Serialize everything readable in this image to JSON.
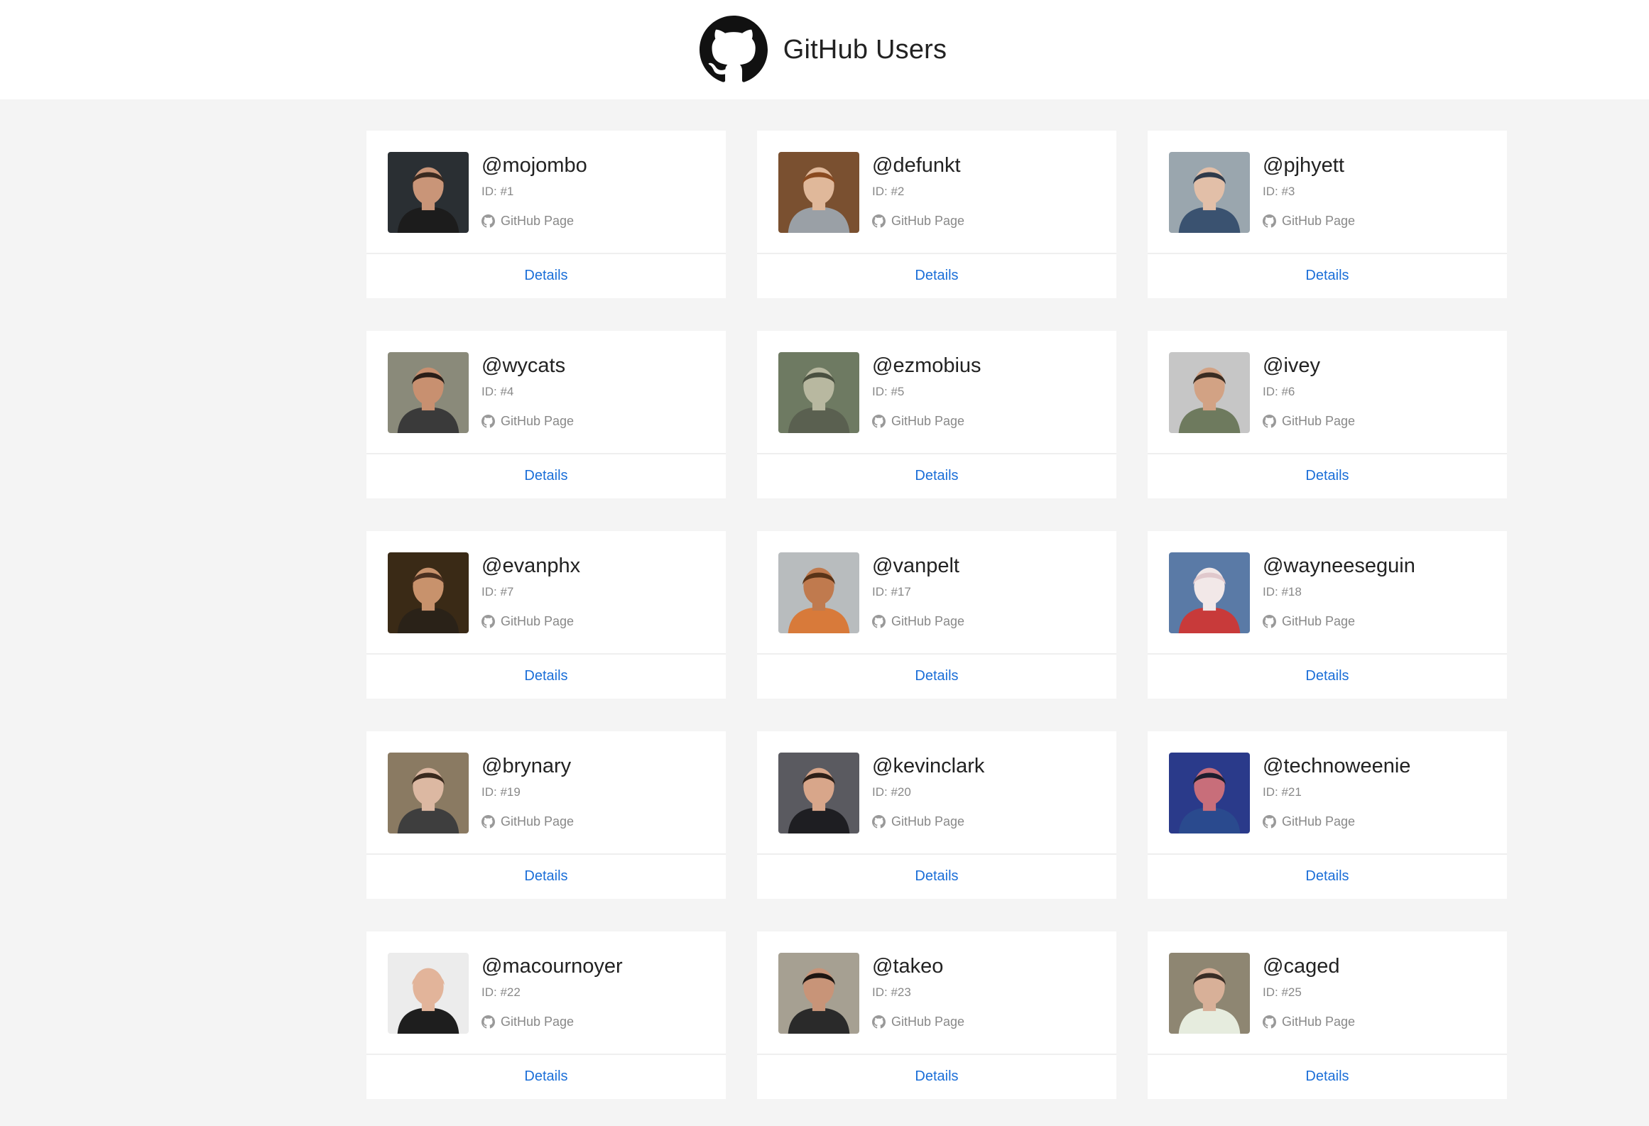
{
  "header": {
    "title": "GitHub Users",
    "logo_icon": "github-octocat-icon"
  },
  "colors": {
    "link": "#1a6ed8",
    "background": "#f4f4f4",
    "card": "#ffffff",
    "muted": "#888888"
  },
  "users": [
    {
      "login": "@mojombo",
      "id": "ID: #1",
      "link_label": "GitHub Page",
      "details_label": "Details",
      "avatar": {
        "bg": "#2a2f33",
        "skin": "#c99578",
        "hair": "#3a2a20",
        "shirt": "#1c1c1c"
      }
    },
    {
      "login": "@defunkt",
      "id": "ID: #2",
      "link_label": "GitHub Page",
      "details_label": "Details",
      "avatar": {
        "bg": "#7a5030",
        "skin": "#e0b89a",
        "hair": "#8a4a20",
        "shirt": "#9aa0a6"
      }
    },
    {
      "login": "@pjhyett",
      "id": "ID: #3",
      "link_label": "GitHub Page",
      "details_label": "Details",
      "avatar": {
        "bg": "#9aa6ae",
        "skin": "#e2bfa8",
        "hair": "#2f3a4a",
        "shirt": "#3a5270"
      }
    },
    {
      "login": "@wycats",
      "id": "ID: #4",
      "link_label": "GitHub Page",
      "details_label": "Details",
      "avatar": {
        "bg": "#8a8a7a",
        "skin": "#c89070",
        "hair": "#2a1e18",
        "shirt": "#3a3a3a"
      }
    },
    {
      "login": "@ezmobius",
      "id": "ID: #5",
      "link_label": "GitHub Page",
      "details_label": "Details",
      "avatar": {
        "bg": "#6e7a62",
        "skin": "#b8b8a0",
        "hair": "#4a5040",
        "shirt": "#5a6050"
      }
    },
    {
      "login": "@ivey",
      "id": "ID: #6",
      "link_label": "GitHub Page",
      "details_label": "Details",
      "avatar": {
        "bg": "#c6c6c6",
        "skin": "#d2a284",
        "hair": "#3a2c22",
        "shirt": "#6e7a5e"
      }
    },
    {
      "login": "@evanphx",
      "id": "ID: #7",
      "link_label": "GitHub Page",
      "details_label": "Details",
      "avatar": {
        "bg": "#3a2a16",
        "skin": "#c8926c",
        "hair": "#4a3020",
        "shirt": "#2a2218"
      }
    },
    {
      "login": "@vanpelt",
      "id": "ID: #17",
      "link_label": "GitHub Page",
      "details_label": "Details",
      "avatar": {
        "bg": "#b8bcbe",
        "skin": "#c07a4e",
        "hair": "#5a3418",
        "shirt": "#d87a3a"
      }
    },
    {
      "login": "@wayneeseguin",
      "id": "ID: #18",
      "link_label": "GitHub Page",
      "details_label": "Details",
      "avatar": {
        "bg": "#5a7aa6",
        "skin": "#f2e8e8",
        "hair": "#e0c8cc",
        "shirt": "#c83a3a"
      }
    },
    {
      "login": "@brynary",
      "id": "ID: #19",
      "link_label": "GitHub Page",
      "details_label": "Details",
      "avatar": {
        "bg": "#8a7a62",
        "skin": "#dcb8a2",
        "hair": "#3a2a1e",
        "shirt": "#3e3e3e"
      }
    },
    {
      "login": "@kevinclark",
      "id": "ID: #20",
      "link_label": "GitHub Page",
      "details_label": "Details",
      "avatar": {
        "bg": "#5a5a60",
        "skin": "#d8a68a",
        "hair": "#2e2018",
        "shirt": "#1e1e22"
      }
    },
    {
      "login": "@technoweenie",
      "id": "ID: #21",
      "link_label": "GitHub Page",
      "details_label": "Details",
      "avatar": {
        "bg": "#2a3a8a",
        "skin": "#c86e7a",
        "hair": "#1e1e2e",
        "shirt": "#2a4a8e"
      }
    },
    {
      "login": "@macournoyer",
      "id": "ID: #22",
      "link_label": "GitHub Page",
      "details_label": "Details",
      "avatar": {
        "bg": "#ececec",
        "skin": "#e2b49a",
        "hair": "#e2b49a",
        "shirt": "#1e1e1e"
      }
    },
    {
      "login": "@takeo",
      "id": "ID: #23",
      "link_label": "GitHub Page",
      "details_label": "Details",
      "avatar": {
        "bg": "#a6a092",
        "skin": "#c89478",
        "hair": "#1e1612",
        "shirt": "#2a2a2a"
      }
    },
    {
      "login": "@caged",
      "id": "ID: #25",
      "link_label": "GitHub Page",
      "details_label": "Details",
      "avatar": {
        "bg": "#8e8672",
        "skin": "#d8b098",
        "hair": "#3a2e26",
        "shirt": "#e6ecde"
      }
    }
  ]
}
